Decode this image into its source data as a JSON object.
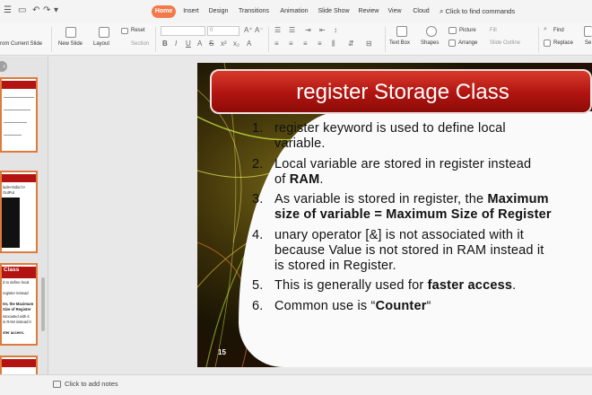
{
  "menubar": {
    "tabs": [
      {
        "label": "Home",
        "active": true
      },
      {
        "label": "Insert"
      },
      {
        "label": "Design"
      },
      {
        "label": "Transitions"
      },
      {
        "label": "Animation"
      },
      {
        "label": "Slide Show"
      },
      {
        "label": "Review"
      },
      {
        "label": "View"
      },
      {
        "label": "Cloud"
      }
    ],
    "find_commands": "Click to find commands",
    "accent": "#f27a4a"
  },
  "ribbon": {
    "from_current_slide": "rom Current Slide",
    "new_slide": "New Slide",
    "layout": "Layout",
    "reset": "Reset",
    "section": "Section",
    "font_size": "0",
    "text_box": "Text Box",
    "shapes": "Shapes",
    "picture": "Picture",
    "arrange": "Arrange",
    "fill": "Fill",
    "slide_outline": "Slide Outline",
    "find": "Find",
    "replace": "Replace",
    "se": "Se"
  },
  "thumbnails": [
    {
      "title": "",
      "lines": []
    },
    {
      "title": "",
      "lines": [
        "lude<stdio.h>",
        "OutPut"
      ]
    },
    {
      "title": "Class",
      "lines": [
        "d to define local",
        "register instead",
        "ter, the Maximum",
        "Size of Register",
        "ssociated with it",
        "in RAM instead it",
        "",
        "ster access."
      ]
    },
    {
      "title": "",
      "lines": []
    }
  ],
  "slide": {
    "title": "register Storage Class",
    "number": "15",
    "points": [
      {
        "num": "1.",
        "lines": [
          [
            {
              "t": "register keyword is used to define local"
            }
          ],
          [
            {
              "t": "variable."
            }
          ]
        ]
      },
      {
        "num": "2.",
        "lines": [
          [
            {
              "t": "Local variable are stored in register instead"
            }
          ],
          [
            {
              "t": "of "
            },
            {
              "t": "RAM",
              "b": true
            },
            {
              "t": "."
            }
          ]
        ]
      },
      {
        "num": "3.",
        "lines": [
          [
            {
              "t": "As variable is stored in register, the "
            },
            {
              "t": "Maximum",
              "b": true
            }
          ],
          [
            {
              "t": "size of variable = Maximum Size of Register",
              "b": true
            }
          ]
        ]
      },
      {
        "num": "4.",
        "lines": [
          [
            {
              "t": "unary operator [&] is not associated with it"
            }
          ],
          [
            {
              "t": "because Value is not stored in RAM instead it"
            }
          ],
          [
            {
              "t": "is stored in Register."
            }
          ]
        ]
      },
      {
        "num": "5.",
        "lines": [
          [
            {
              "t": "This is generally used for "
            },
            {
              "t": "faster access",
              "b": true
            },
            {
              "t": "."
            }
          ]
        ]
      },
      {
        "num": "6.",
        "lines": [
          [
            {
              "t": "Common use is “"
            },
            {
              "t": "Counter",
              "b": true
            },
            {
              "t": "“"
            }
          ]
        ]
      }
    ],
    "title_color": "#b01410"
  },
  "notes": {
    "placeholder": "Click to add notes"
  }
}
